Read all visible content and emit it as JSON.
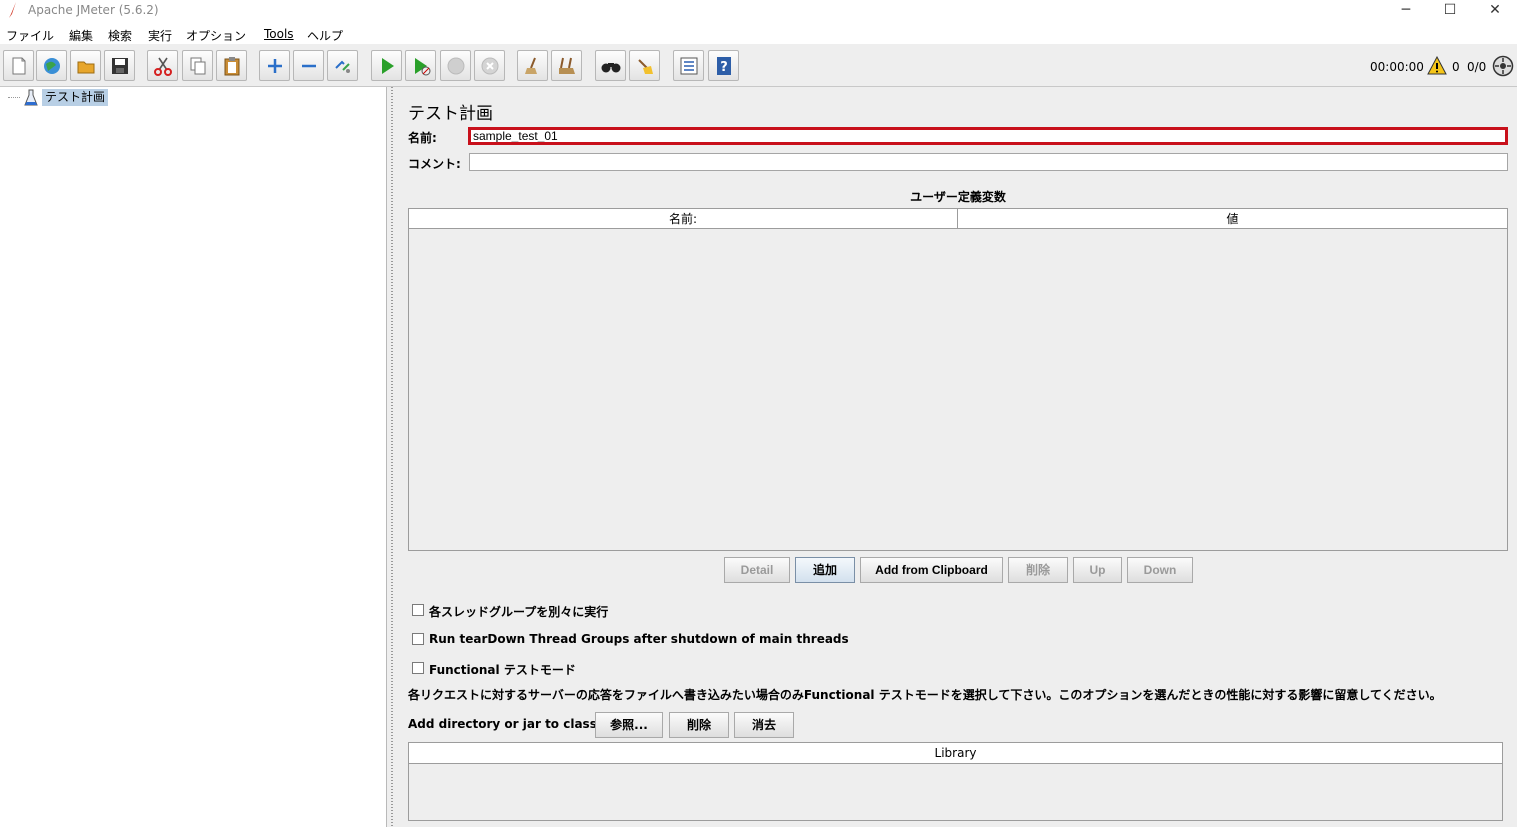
{
  "window": {
    "title": "Apache JMeter (5.6.2)",
    "minimize": "─",
    "maximize": "☐",
    "close": "✕"
  },
  "menu": [
    "ファイル",
    "編集",
    "検索",
    "実行",
    "オプション",
    "Tools",
    "ヘルプ"
  ],
  "toolbar": {
    "buttons": [
      "new-icon",
      "templates-icon",
      "open-icon",
      "save-icon",
      "cut-icon",
      "copy-icon",
      "paste-icon",
      "expand-icon",
      "collapse-icon",
      "toggle-icon",
      "start-icon",
      "start-no-pause-icon",
      "stop-icon",
      "shutdown-icon",
      "clear-icon",
      "clear-all-icon",
      "search-icon",
      "reset-search-icon",
      "function-helper-icon",
      "help-icon"
    ],
    "timer": "00:00:00",
    "warning_count": "0",
    "thread_count": "0/0"
  },
  "tree": {
    "root_label": "テスト計画"
  },
  "test_plan": {
    "title": "テスト計画",
    "name_label": "名前:",
    "name_value": "sample_test_01",
    "comment_label": "コメント:",
    "comment_value": "",
    "udv_title": "ユーザー定義変数",
    "udv_columns": [
      "名前:",
      "値"
    ],
    "buttons": [
      "Detail",
      "追加",
      "Add from Clipboard",
      "削除",
      "Up",
      "Down"
    ],
    "checkboxes": [
      {
        "label": "各スレッドグループを別々に実行",
        "checked": false
      },
      {
        "label": "Run tearDown Thread Groups after shutdown of main threads",
        "checked": false
      },
      {
        "label": "Functional テストモード",
        "checked": false
      }
    ],
    "functional_note": "各リクエストに対するサーバーの応答をファイルへ書き込みたい場合のみFunctional テストモードを選択して下さい。このオプションを選んだときの性能に対する影響に留意してください。",
    "classpath_label": "Add directory or jar to classpath",
    "classpath_buttons": [
      "参照...",
      "削除",
      "消去"
    ],
    "library_column": "Library"
  }
}
